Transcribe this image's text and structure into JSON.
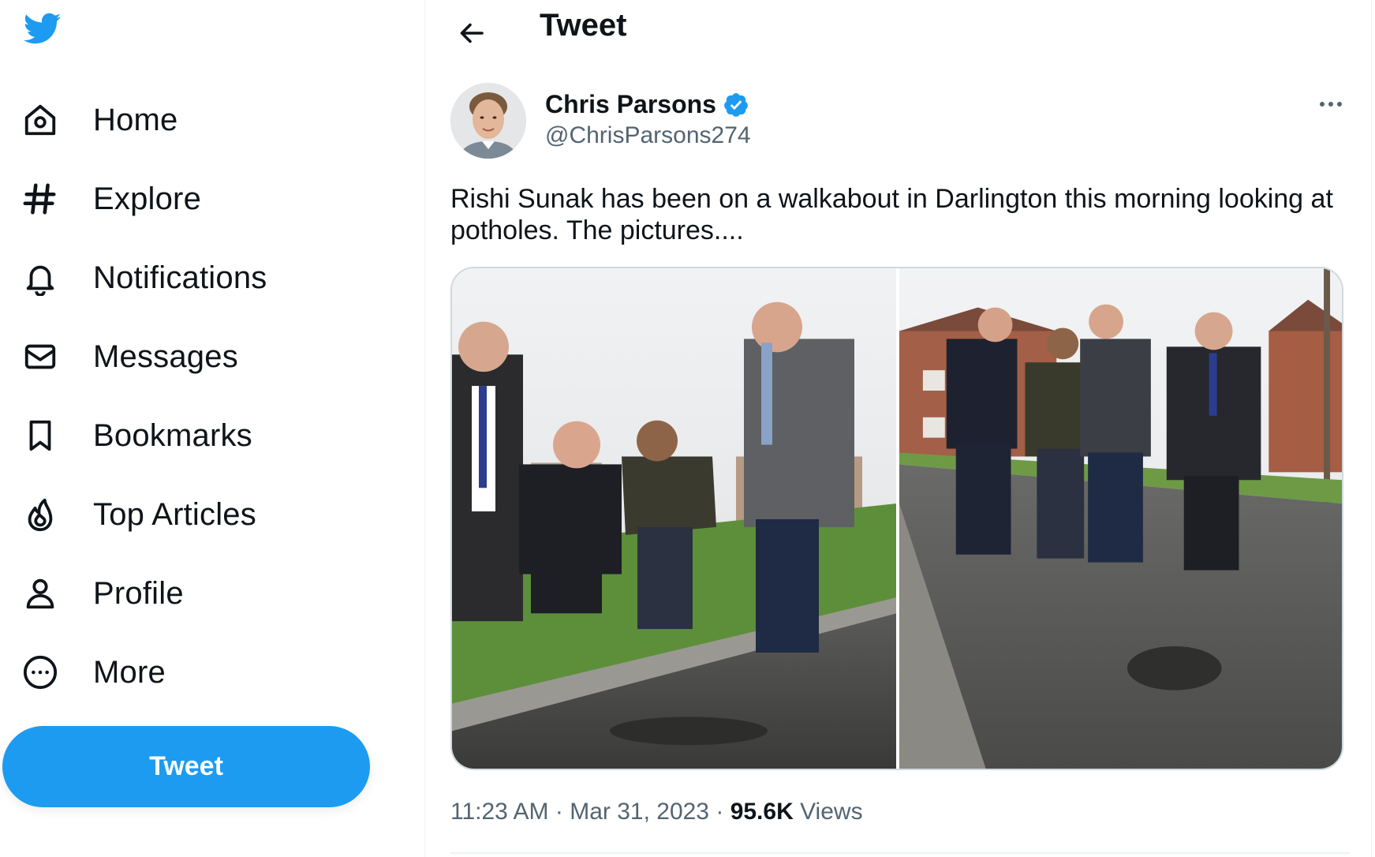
{
  "sidebar": {
    "logo": "twitter-bird-icon",
    "items": [
      {
        "label": "Home",
        "icon": "home-icon"
      },
      {
        "label": "Explore",
        "icon": "hashtag-icon"
      },
      {
        "label": "Notifications",
        "icon": "bell-icon"
      },
      {
        "label": "Messages",
        "icon": "envelope-icon"
      },
      {
        "label": "Bookmarks",
        "icon": "bookmark-icon"
      },
      {
        "label": "Top Articles",
        "icon": "flame-icon"
      },
      {
        "label": "Profile",
        "icon": "person-icon"
      },
      {
        "label": "More",
        "icon": "more-circle-icon"
      }
    ],
    "tweet_button": "Tweet"
  },
  "header": {
    "title": "Tweet",
    "back_icon": "arrow-left-icon"
  },
  "tweet": {
    "author": {
      "name": "Chris Parsons",
      "handle": "@ChrisParsons274",
      "verified": true
    },
    "text": "Rishi Sunak has been on a walkabout in Darlington this morning looking at potholes. The pictures....",
    "media_count": 2,
    "time": "11:23 AM",
    "separator": "·",
    "date": "Mar 31, 2023",
    "views_count": "95.6K",
    "views_label": "Views"
  },
  "colors": {
    "accent": "#1d9bf0",
    "text_primary": "#0f1419",
    "text_secondary": "#536471",
    "border": "#cfd9de"
  }
}
